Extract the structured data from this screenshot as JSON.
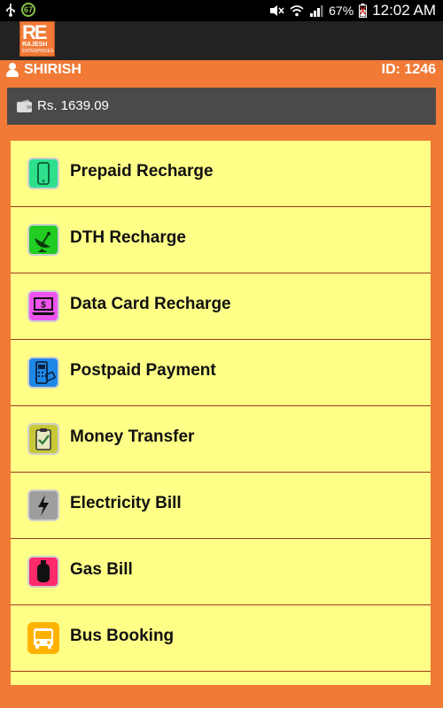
{
  "statusbar": {
    "notification_badge": "67",
    "battery": "67%",
    "time": "12:02 AM"
  },
  "app": {
    "logo_big": "RE",
    "logo_name": "RAJESH",
    "logo_tagline": "ENTERPRISES"
  },
  "user": {
    "name": "SHIRISH",
    "id_label": "ID: 1246"
  },
  "balance": {
    "amount": "Rs. 1639.09"
  },
  "menu": {
    "items": [
      {
        "label": "Prepaid Recharge",
        "icon": "mobile-phone-icon",
        "color": "#2ee08c"
      },
      {
        "label": "DTH Recharge",
        "icon": "satellite-dish-icon",
        "color": "#22cc22"
      },
      {
        "label": "Data Card Recharge",
        "icon": "laptop-dollar-icon",
        "color": "#ee55ee"
      },
      {
        "label": "Postpaid Payment",
        "icon": "card-machine-icon",
        "color": "#1e88e5"
      },
      {
        "label": "Money Transfer",
        "icon": "clipboard-check-icon",
        "color": "#c9c938"
      },
      {
        "label": "Electricity Bill",
        "icon": "lightning-bolt-icon",
        "color": "#9e9e9e"
      },
      {
        "label": "Gas Bill",
        "icon": "gas-cylinder-icon",
        "color": "#ff2a6a"
      },
      {
        "label": "Bus Booking",
        "icon": "bus-icon",
        "color": "#ffb300"
      }
    ]
  },
  "colors": {
    "accent": "#f07a36",
    "menu_bg": "#ffff88",
    "divider": "#9a3a1e"
  }
}
